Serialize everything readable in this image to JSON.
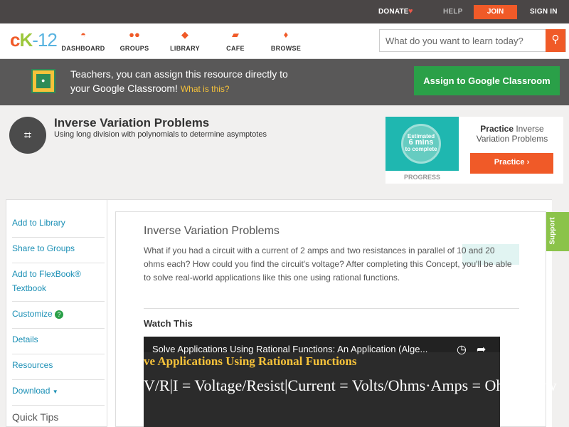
{
  "topbar": {
    "donate": "DONATE",
    "help": "HELP",
    "join": "JOIN",
    "signin": "SIGN IN"
  },
  "nav": {
    "logo": {
      "c": "c",
      "k": "K",
      "num": "-12"
    },
    "items": [
      {
        "label": "DASHBOARD",
        "icon": "dashboard-icon"
      },
      {
        "label": "GROUPS",
        "icon": "groups-icon"
      },
      {
        "label": "LIBRARY",
        "icon": "library-icon"
      },
      {
        "label": "CAFE",
        "icon": "cafe-icon"
      },
      {
        "label": "BROWSE",
        "icon": "browse-icon"
      }
    ],
    "search_placeholder": "What do you want to learn today?"
  },
  "banner": {
    "line1": "Teachers, you can assign this resource directly to",
    "line2": "your Google Classroom!",
    "what": "What is this?",
    "assign": "Assign to Google Classroom"
  },
  "header": {
    "title": "Inverse Variation Problems",
    "subtitle": "Using long division with polynomials to determine asymptotes"
  },
  "practice": {
    "estimated": "Estimated",
    "mins": "6 mins",
    "complete": "to complete",
    "progress_label": "PROGRESS",
    "title_bold": "Practice",
    "title_rest": "Inverse Variation Problems",
    "button": "Practice"
  },
  "sidebar": {
    "items": [
      "Add to Library",
      "Share to Groups",
      "Add to FlexBook®",
      "Textbook",
      "Customize",
      "Details",
      "Resources",
      "Download"
    ],
    "quick_tips": "Quick Tips"
  },
  "article": {
    "title": "Inverse Variation Problems",
    "text": "What if you had a circuit with a current of 2 amps and two resistances in parallel of 10 and 20 ohms each? How could you find the circuit's voltage? After completing this Concept, you'll be able to solve real-world applications like this one using rational functions.",
    "watch": "Watch This"
  },
  "video": {
    "title": "Solve Applications Using Rational Functions: An Application (Alge...",
    "board_heading": "ve Applications Using Rational Functions",
    "board_equation": "V/R|I = Voltage/Resist|Current = Volts/Ohms·Amps = Ohm's Law"
  },
  "support": "Support"
}
